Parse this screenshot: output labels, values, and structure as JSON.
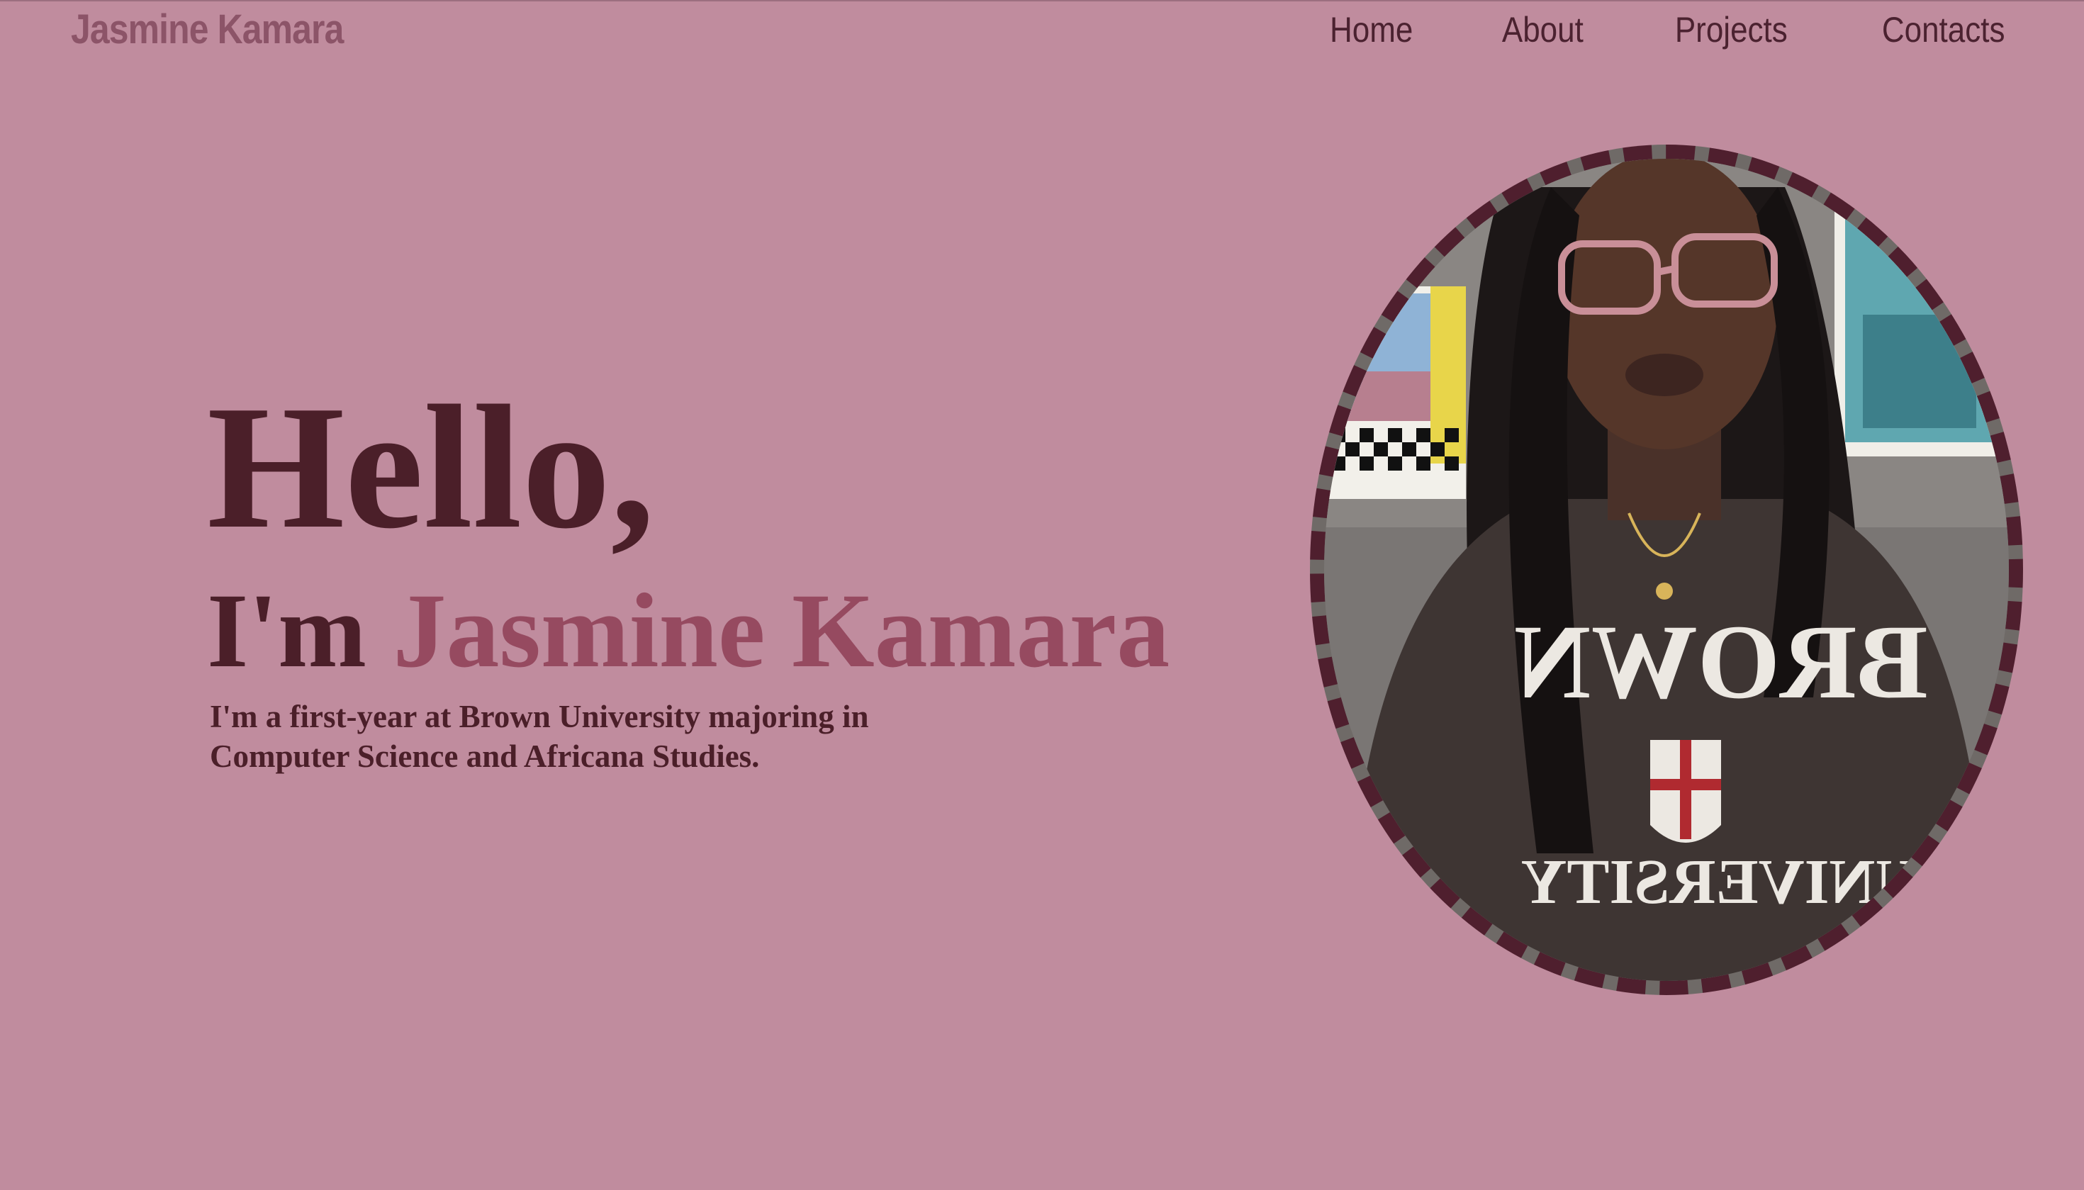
{
  "header": {
    "brand": "Jasmine Kamara",
    "nav": [
      {
        "label": "Home"
      },
      {
        "label": "About"
      },
      {
        "label": "Projects"
      },
      {
        "label": "Contacts"
      }
    ]
  },
  "hero": {
    "greeting": "Hello,",
    "intro_prefix": "I'm ",
    "name": "Jasmine Kamara",
    "tagline": "I'm a first-year at Brown University majoring in Computer Science and Africana Studies."
  },
  "colors": {
    "background": "#c08c9e",
    "heading": "#4b1f29",
    "accent": "#964a60",
    "brand": "#8c5468",
    "frame": "#4f1f2e"
  },
  "photo": {
    "sweatshirt_top": "BROWN",
    "sweatshirt_bottom": "UNIVERSITY"
  }
}
